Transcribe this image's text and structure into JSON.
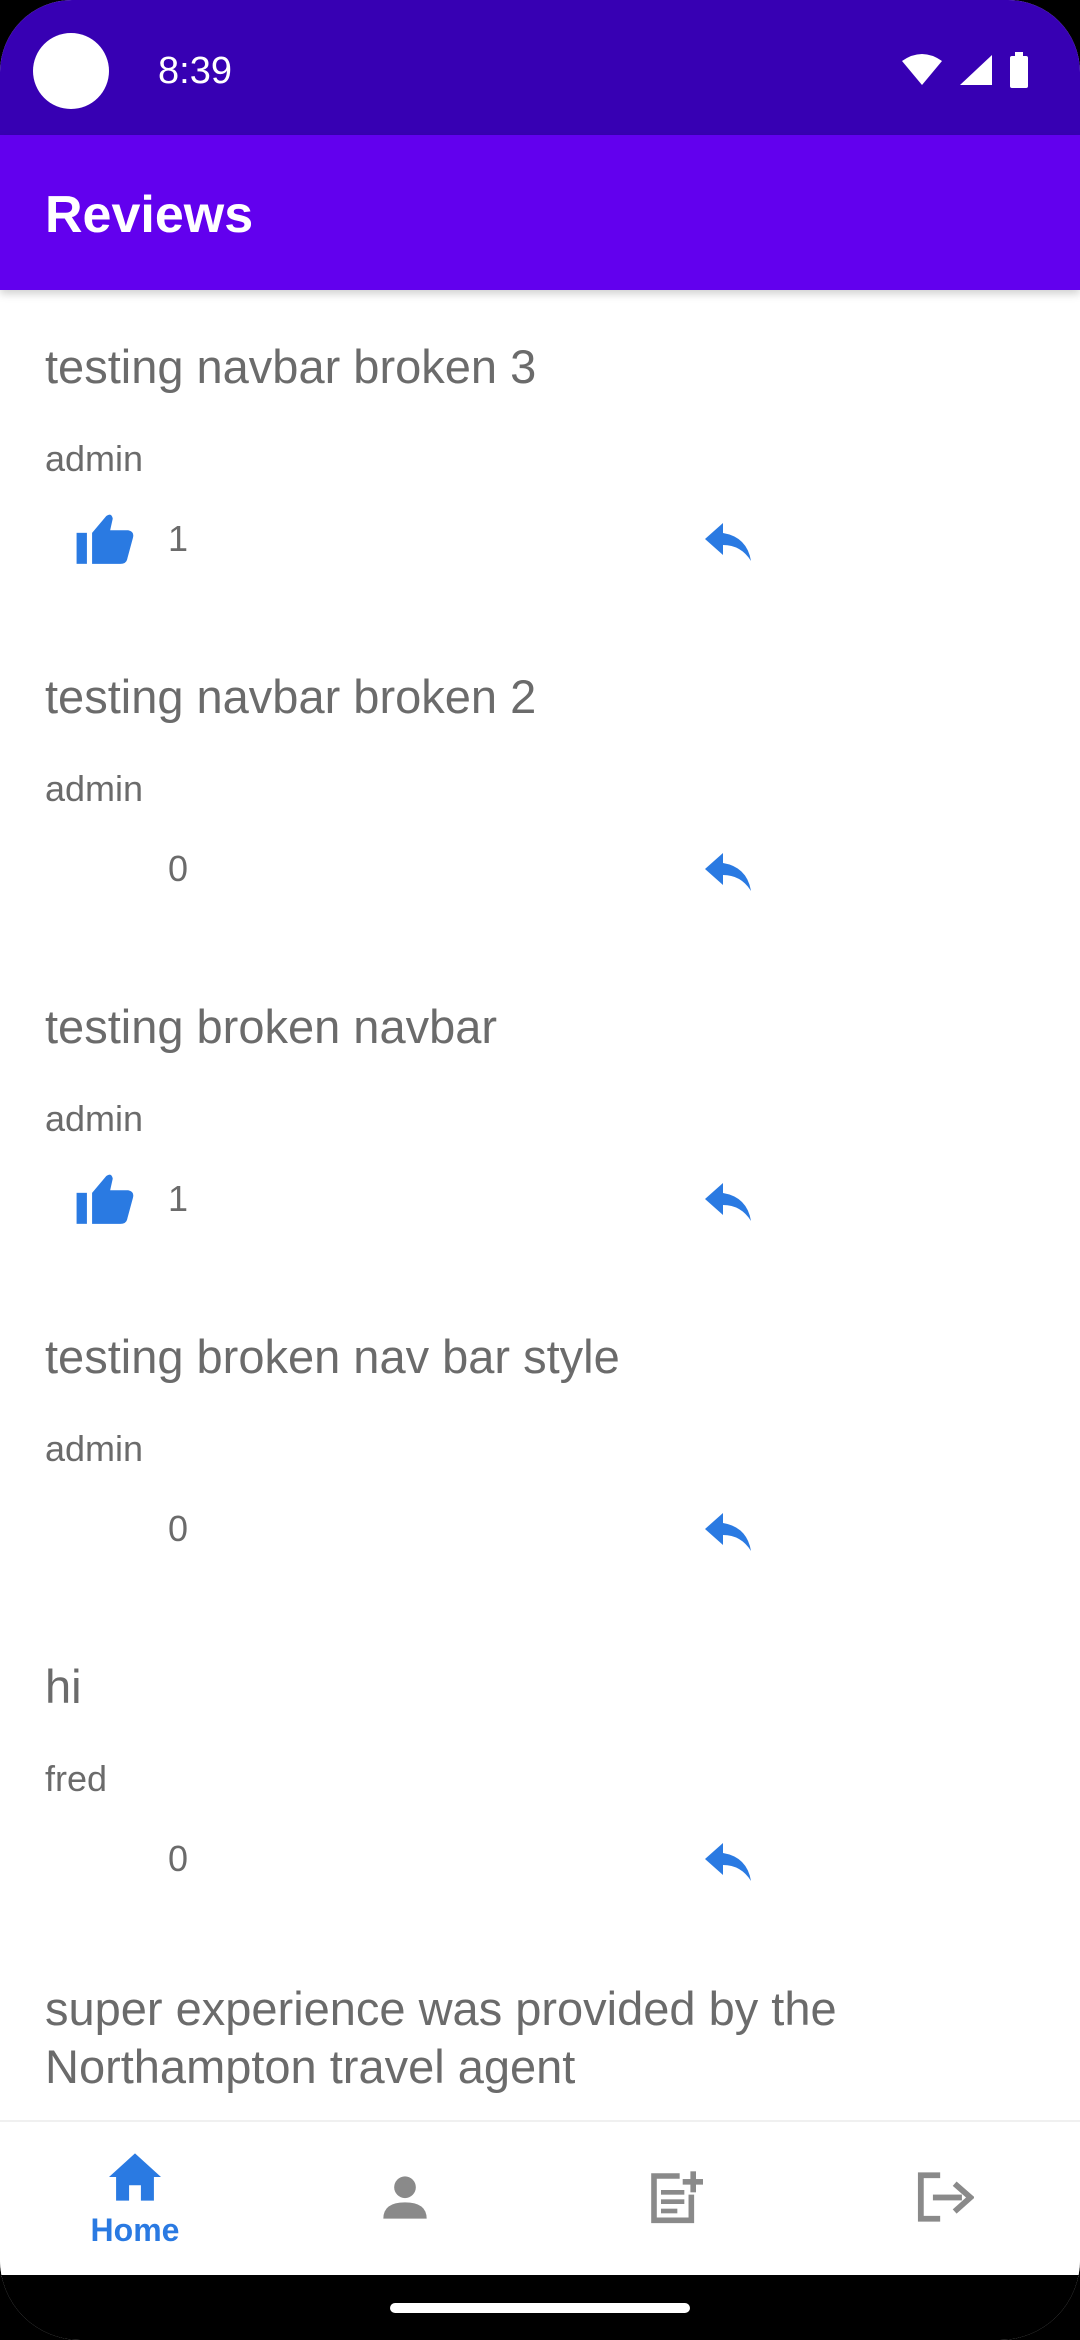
{
  "status_bar": {
    "time": "8:39"
  },
  "app_bar": {
    "title": "Reviews"
  },
  "reviews": [
    {
      "title": "testing navbar broken 3",
      "author": "admin",
      "likes": "1",
      "liked": true
    },
    {
      "title": "testing navbar broken 2",
      "author": "admin",
      "likes": "0",
      "liked": false
    },
    {
      "title": "testing broken navbar",
      "author": "admin",
      "likes": "1",
      "liked": true
    },
    {
      "title": "testing broken nav bar style",
      "author": "admin",
      "likes": "0",
      "liked": false
    },
    {
      "title": "hi",
      "author": "fred",
      "likes": "0",
      "liked": false
    },
    {
      "title": "super experience was provided by the Northampton travel agent",
      "author": "",
      "likes": "",
      "liked": false
    }
  ],
  "bottom_nav": {
    "home_label": "Home",
    "items": [
      {
        "icon": "home-icon",
        "label": "Home",
        "active": true
      },
      {
        "icon": "person-icon",
        "label": "",
        "active": false
      },
      {
        "icon": "add-post-icon",
        "label": "",
        "active": false
      },
      {
        "icon": "logout-icon",
        "label": "",
        "active": false
      }
    ]
  },
  "colors": {
    "status_bar": "#3700b3",
    "app_bar": "#6200ee",
    "accent": "#2a7ae2",
    "text": "#6b6b6b",
    "inactive_icon": "#8a8a8a"
  }
}
